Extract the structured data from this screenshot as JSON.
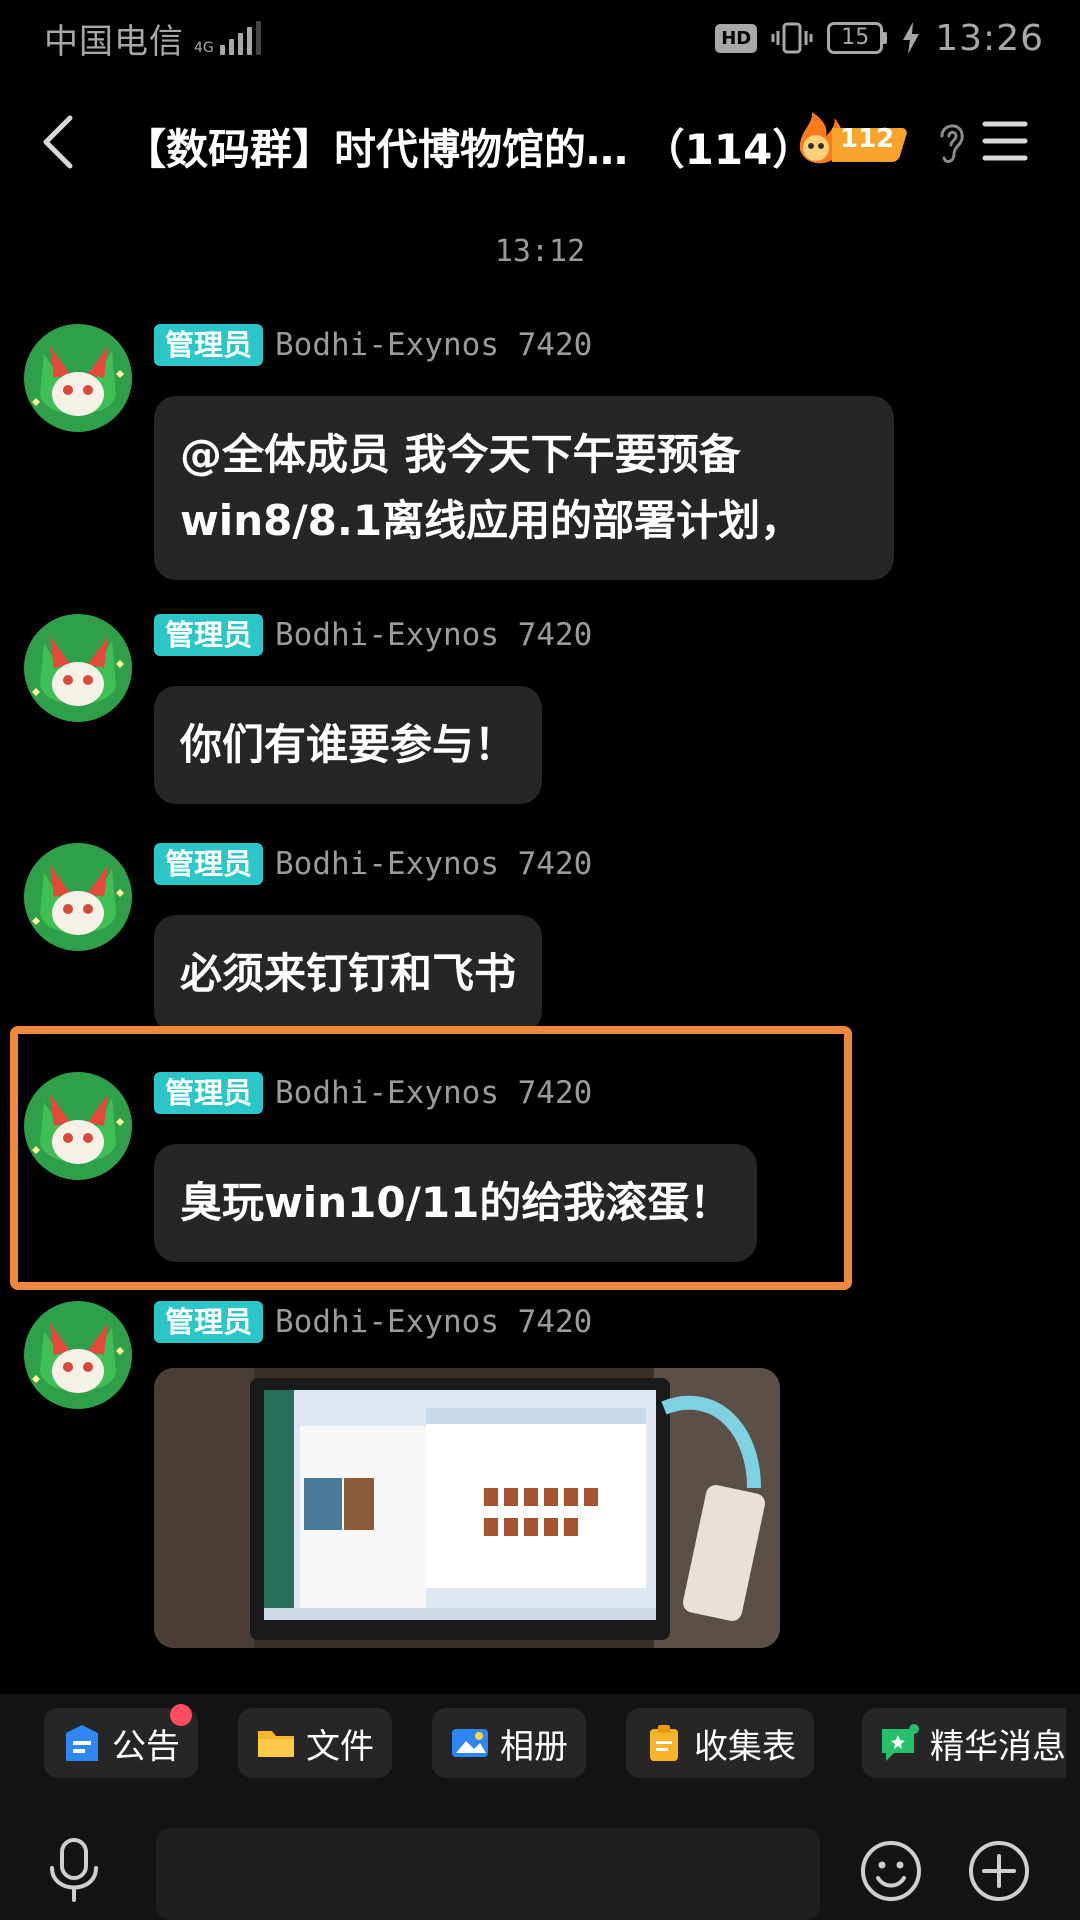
{
  "status_bar": {
    "carrier": "中国电信",
    "network": "4G",
    "hd": "HD",
    "battery": "15",
    "time": "13:26"
  },
  "header": {
    "title": "【数码群】时代博物馆的… （114）",
    "fire_count": "112"
  },
  "chat": {
    "time_separator": "13:12",
    "messages": [
      {
        "role": "管理员",
        "sender": "Bodhi-Exynos 7420",
        "text_line1": "@全体成员  我今天下午要预备",
        "text_line2": "win8/8.1离线应用的部署计划，"
      },
      {
        "role": "管理员",
        "sender": "Bodhi-Exynos 7420",
        "text": "你们有谁要参与！"
      },
      {
        "role": "管理员",
        "sender": "Bodhi-Exynos 7420",
        "text": "必须来钉钉和飞书"
      },
      {
        "role": "管理员",
        "sender": "Bodhi-Exynos 7420",
        "text": "臭玩win10/11的给我滚蛋！"
      },
      {
        "role": "管理员",
        "sender": "Bodhi-Exynos 7420"
      }
    ]
  },
  "toolbar": {
    "chips": [
      {
        "label": "公告",
        "icon": "announcement-icon",
        "unread": true
      },
      {
        "label": "文件",
        "icon": "folder-icon"
      },
      {
        "label": "相册",
        "icon": "album-icon"
      },
      {
        "label": "收集表",
        "icon": "clipboard-icon"
      },
      {
        "label": "精华消息",
        "icon": "essence-icon"
      }
    ],
    "input_placeholder": ""
  },
  "colors": {
    "background": "#000000",
    "bubble": "#262626",
    "admin_badge": "#2cc6c8",
    "highlight_border": "#f0883c",
    "unread_dot": "#ff4d5e"
  }
}
